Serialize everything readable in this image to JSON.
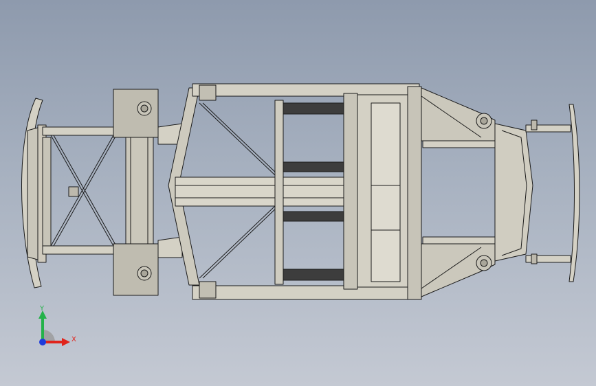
{
  "viewport": {
    "background_top": "#8e9aad",
    "background_bottom": "#c4c9d3"
  },
  "model": {
    "frame_fill": "#d4d1c5",
    "frame_fill_dark": "#b9b6aa",
    "edge_color": "#1a1a1a"
  },
  "triad": {
    "x_label": "X",
    "y_label": "Y",
    "x_color": "#e0241c",
    "y_color": "#24b24a",
    "z_color": "#1e3cdc"
  }
}
